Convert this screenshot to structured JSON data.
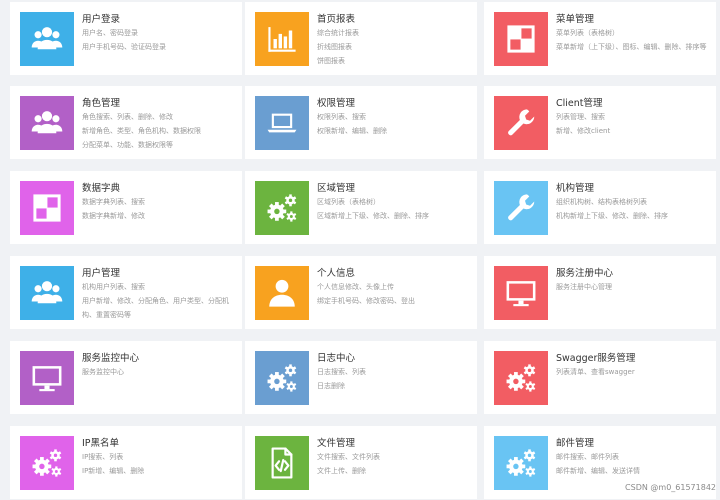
{
  "colors": {
    "blue": "#3eb0e8",
    "orange": "#f8a21f",
    "red": "#f25d63",
    "purple": "#b260c7",
    "steelblue": "#6a9ed1",
    "magenta": "#e063ea",
    "green": "#6cb43f",
    "skyblue": "#69c4f3",
    "background": "#f0f2f5"
  },
  "cards": [
    {
      "title": "用户登录",
      "icon": "users-icon",
      "color": "#3eb0e8",
      "desc": [
        "用户名、密码登录",
        "用户手机号码、验证码登录"
      ]
    },
    {
      "title": "首页报表",
      "icon": "bar-chart-icon",
      "color": "#f8a21f",
      "desc": [
        "综合统计报表",
        "折线图报表",
        "饼图报表"
      ]
    },
    {
      "title": "菜单管理",
      "icon": "layout-icon",
      "color": "#f25d63",
      "desc": [
        "菜单列表（表格树）",
        "菜单新增（上下级）、图标、编辑、删除、排序等"
      ]
    },
    {
      "title": "角色管理",
      "icon": "users-icon",
      "color": "#b260c7",
      "desc": [
        "角色搜索、列表、删除、修改",
        "新增角色、类型、角色机构、数据权限",
        "分配菜单、功能、数据权限等"
      ]
    },
    {
      "title": "权限管理",
      "icon": "laptop-icon",
      "color": "#6a9ed1",
      "desc": [
        "权限列表、搜索",
        "权限新增、编辑、删除"
      ]
    },
    {
      "title": "Client管理",
      "icon": "wrench-icon",
      "color": "#f25d63",
      "desc": [
        "列表管理、搜索",
        "新增、修改client"
      ]
    },
    {
      "title": "数据字典",
      "icon": "layout-icon",
      "color": "#e063ea",
      "desc": [
        "数据字典列表、搜索",
        "数据字典新增、修改"
      ]
    },
    {
      "title": "区域管理",
      "icon": "gears-icon",
      "color": "#6cb43f",
      "desc": [
        "区域列表（表格树）",
        "区域新增上下级、修改、删除、排序"
      ]
    },
    {
      "title": "机构管理",
      "icon": "wrench-icon",
      "color": "#69c4f3",
      "desc": [
        "组织机构树、结构表格树列表",
        "机构新增上下级、修改、删除、排序"
      ]
    },
    {
      "title": "用户管理",
      "icon": "users-icon",
      "color": "#3eb0e8",
      "desc": [
        "机构用户列表、搜索",
        "用户新增、修改、分配角色、用户类型、分配机构、重置密码等"
      ]
    },
    {
      "title": "个人信息",
      "icon": "person-icon",
      "color": "#f8a21f",
      "desc": [
        "个人信息修改、头像上传",
        "绑定手机号码、修改密码、登出"
      ]
    },
    {
      "title": "服务注册中心",
      "icon": "monitor-icon",
      "color": "#f25d63",
      "desc": [
        "服务注册中心管理"
      ]
    },
    {
      "title": "服务监控中心",
      "icon": "monitor-icon",
      "color": "#b260c7",
      "desc": [
        "服务监控中心"
      ]
    },
    {
      "title": "日志中心",
      "icon": "gears-icon",
      "color": "#6a9ed1",
      "desc": [
        "日志搜索、列表",
        "日志删除"
      ]
    },
    {
      "title": "Swagger服务管理",
      "icon": "gears-icon",
      "color": "#f25d63",
      "desc": [
        "列表清单、查看swagger"
      ]
    },
    {
      "title": "IP黑名单",
      "icon": "gears-icon",
      "color": "#e063ea",
      "desc": [
        "IP搜索、列表",
        "IP新增、编辑、删除"
      ]
    },
    {
      "title": "文件管理",
      "icon": "code-file-icon",
      "color": "#6cb43f",
      "desc": [
        "文件搜索、文件列表",
        "文件上传、删除"
      ]
    },
    {
      "title": "邮件管理",
      "icon": "gears-icon",
      "color": "#69c4f3",
      "desc": [
        "邮件搜索、邮件列表",
        "邮件新增、编辑、发送详情"
      ]
    }
  ],
  "watermark": "CSDN @m0_61571842"
}
